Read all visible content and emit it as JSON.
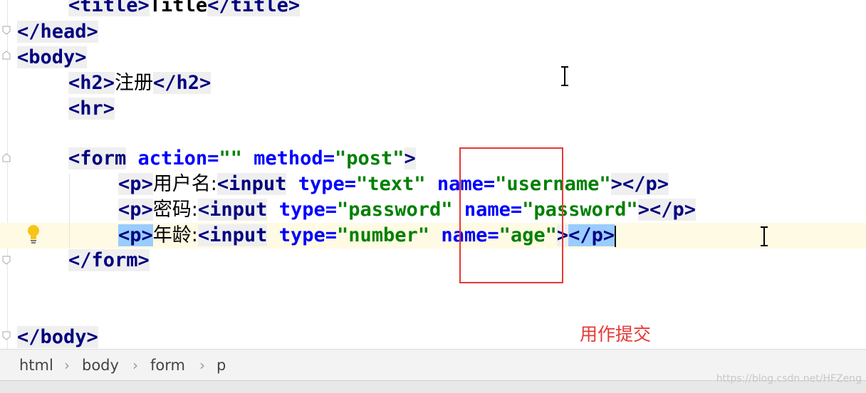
{
  "code": {
    "line_title": {
      "open": "<title>",
      "text": "Title",
      "close": "</title>"
    },
    "line_head_close": {
      "tag": "</head>"
    },
    "line_body_open": {
      "tag": "<body>"
    },
    "line_h2": {
      "open": "<h2>",
      "text": "注册",
      "close": "</h2>"
    },
    "line_hr": {
      "tag": "<hr>"
    },
    "line_form": {
      "open": "<form",
      "attr1": "action",
      "eq1": "=",
      "val1": "\"\"",
      "attr2": "method",
      "eq2": "=",
      "val2": "\"post\"",
      "close": ">"
    },
    "line_p1": {
      "open": "<p>",
      "label": "用户名:",
      "input": "<input",
      "attr1": "type",
      "eq1": "=",
      "val1": "\"text\"",
      "attr2": "name",
      "eq2": "=",
      "val2": "\"username\"",
      "gt": ">",
      "pclose": "</p>"
    },
    "line_p2": {
      "open": "<p>",
      "label": "密码:",
      "input": "<input",
      "attr1": "type",
      "eq1": "=",
      "val1": "\"password\"",
      "attr2": "name",
      "eq2": "=",
      "val2": "\"password\"",
      "gt": ">",
      "pclose": "</p>"
    },
    "line_p3": {
      "open": "<p>",
      "label": "年龄:",
      "input": "<input",
      "attr1": "type",
      "eq1": "=",
      "val1": "\"number\"",
      "attr2": "name",
      "eq2": "=",
      "val2": "\"age\"",
      "gt": ">",
      "pclose": "</p>"
    },
    "line_form_close": {
      "tag": "</form>"
    },
    "line_body_close": {
      "tag": "</body>"
    }
  },
  "annotation": {
    "text": "用作提交",
    "color": "#e53935"
  },
  "breadcrumb": {
    "items": [
      "html",
      "body",
      "form",
      "p"
    ],
    "separator": "›"
  },
  "watermark": {
    "text": "https://blog.csdn.net/HFZeng"
  },
  "colors": {
    "tag": "#000080",
    "attribute": "#0000ff",
    "value": "#008000",
    "current_line": "#fffae3",
    "highlight": "#e53935"
  },
  "icons": {
    "bulb": "lightbulb-icon",
    "fold": "fold-marker-icon",
    "cursor": "text-cursor-icon"
  }
}
